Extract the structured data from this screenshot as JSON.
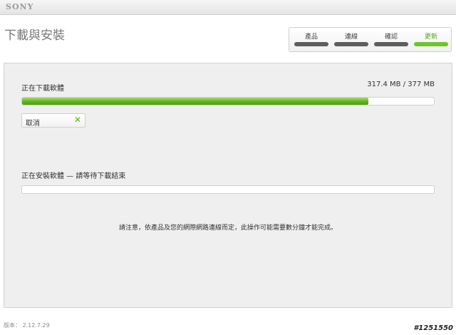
{
  "app": {
    "brand": "SONY",
    "page_title": "下載與安裝"
  },
  "steps": [
    {
      "label": "產品",
      "state": "done"
    },
    {
      "label": "連線",
      "state": "done"
    },
    {
      "label": "確認",
      "state": "done"
    },
    {
      "label": "更新",
      "state": "active"
    }
  ],
  "download": {
    "label": "正在下載軟體",
    "size_text": "317.4 MB / 377 MB",
    "progress": 0.84,
    "cancel_label": "取消"
  },
  "install": {
    "label": "正在安裝軟體 — 請等待下載結束",
    "progress": 0
  },
  "notice": "請注意，依產品及您的網際網路連線而定，此操作可能需要數分鐘才能完成。",
  "version": "版本： 2.12.7.29",
  "watermark": "#1251550",
  "colors": {
    "accent": "#6ec52a",
    "step_inactive": "#5e5e5e",
    "panel_bg": "#efefef"
  }
}
